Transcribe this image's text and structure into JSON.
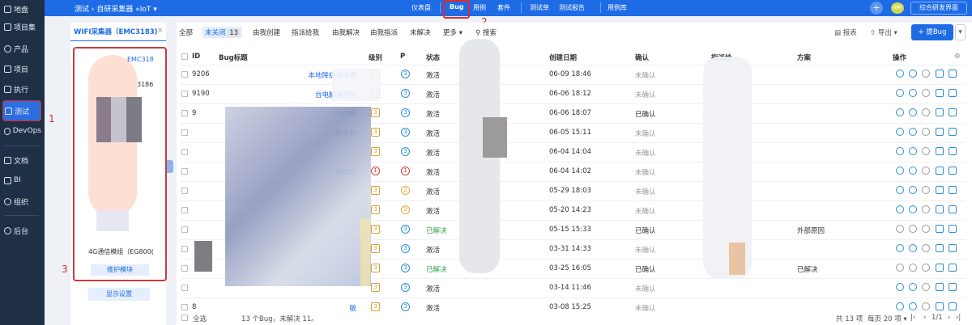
{
  "topbar": {
    "breadcrumb": "测试 › 自研采集器 »IoT ▾",
    "nav": [
      "仪表盘",
      "Bug",
      "用例",
      "套件",
      "测试单",
      "测试报告",
      "用例库"
    ],
    "right_button": "综合研发界面",
    "avatar_label": "柳明"
  },
  "leftnav": {
    "items": [
      "地盘",
      "项目集",
      "产品",
      "项目",
      "执行",
      "测试",
      "DevOps",
      "文档",
      "BI",
      "组织",
      "后台"
    ]
  },
  "panel": {
    "tab_title": "WIFI采集器（EMC3183)",
    "close": "×",
    "module_label": "4G通信模组（EG800(",
    "maintain_button": "维护模块",
    "display_settings_button": "显示设置",
    "visible_fragments": [
      "EMC318",
      "3186"
    ]
  },
  "filters": {
    "items": [
      "全部",
      "未关闭",
      "由我创建",
      "指派给我",
      "由我解决",
      "由我指派",
      "未解决",
      "更多 ▾"
    ],
    "unclosed_count": "13",
    "search": "搜索",
    "report": "报表",
    "export": "导出 ▾",
    "add_bug": "+ 提Bug"
  },
  "table": {
    "headers": [
      "ID",
      "Bug标题",
      "级别",
      "P",
      "状态",
      "创建日期",
      "确认",
      "指派给",
      "方案",
      "操作"
    ],
    "rows": [
      {
        "id": "9206",
        "title": "本地降级会出现",
        "sev": "3",
        "pri": "3",
        "status": "激活",
        "date": "06-09 18:46",
        "confirm": "未确认",
        "solution": ""
      },
      {
        "id": "9190",
        "title": "台电脑遇发性",
        "sev": "3",
        "pri": "3",
        "status": "激活",
        "date": "06-06 18:12",
        "confirm": "未确认",
        "solution": ""
      },
      {
        "id": "9",
        "title": "灯不闪烁",
        "sev": "3",
        "pri": "3",
        "status": "激活",
        "date": "06-06 18:07",
        "confirm": "已确认",
        "solution": ""
      },
      {
        "id": "",
        "title": "级失败",
        "sev": "3",
        "pri": "3",
        "status": "激活",
        "date": "06-05 15:11",
        "confirm": "未确认",
        "solution": ""
      },
      {
        "id": "",
        "title": "",
        "sev": "3",
        "pri": "3",
        "status": "激活",
        "date": "06-04 14:04",
        "confirm": "未确认",
        "solution": ""
      },
      {
        "id": "",
        "title": "危风险",
        "sev": "1",
        "pri": "1",
        "status": "激活",
        "date": "06-04 14:02",
        "confirm": "未确认",
        "solution": ""
      },
      {
        "id": "",
        "title": "",
        "sev": "3",
        "pri": "2",
        "status": "激活",
        "date": "05-29 18:03",
        "confirm": "未确认",
        "solution": ""
      },
      {
        "id": "",
        "title": "",
        "sev": "3",
        "pri": "2",
        "status": "激活",
        "date": "05-20 14:23",
        "confirm": "未确认",
        "solution": ""
      },
      {
        "id": "",
        "title": "",
        "sev": "3",
        "pri": "3",
        "status": "已解决",
        "date": "05-15 15:33",
        "confirm": "已确认",
        "solution": "外部原因"
      },
      {
        "id": "",
        "title": "",
        "sev": "3",
        "pri": "3",
        "status": "激活",
        "date": "03-31 14:33",
        "confirm": "未确认",
        "solution": ""
      },
      {
        "id": "",
        "title": "",
        "sev": "3",
        "pri": "3",
        "status": "已解决",
        "date": "03-25 16:05",
        "confirm": "已确认",
        "solution": "已解决"
      },
      {
        "id": "",
        "title": "",
        "sev": "3",
        "pri": "3",
        "status": "激活",
        "date": "03-14 11:46",
        "confirm": "未确认",
        "solution": ""
      },
      {
        "id": "8",
        "title": "敏",
        "sev": "3",
        "pri": "3",
        "status": "激活",
        "date": "03-08 15:25",
        "confirm": "未确认",
        "solution": ""
      }
    ]
  },
  "footer": {
    "select_all": "全选",
    "summary": "13 个Bug，未解决 11。",
    "total": "共 13 项",
    "per_page": "每页 20 项 ▾",
    "pager": "1/1"
  },
  "annotations": [
    "1",
    "2",
    "3"
  ],
  "colors": {
    "accent": "#1e6be6",
    "sidebar": "#1f2f46",
    "annotation": "#e02b2b"
  }
}
